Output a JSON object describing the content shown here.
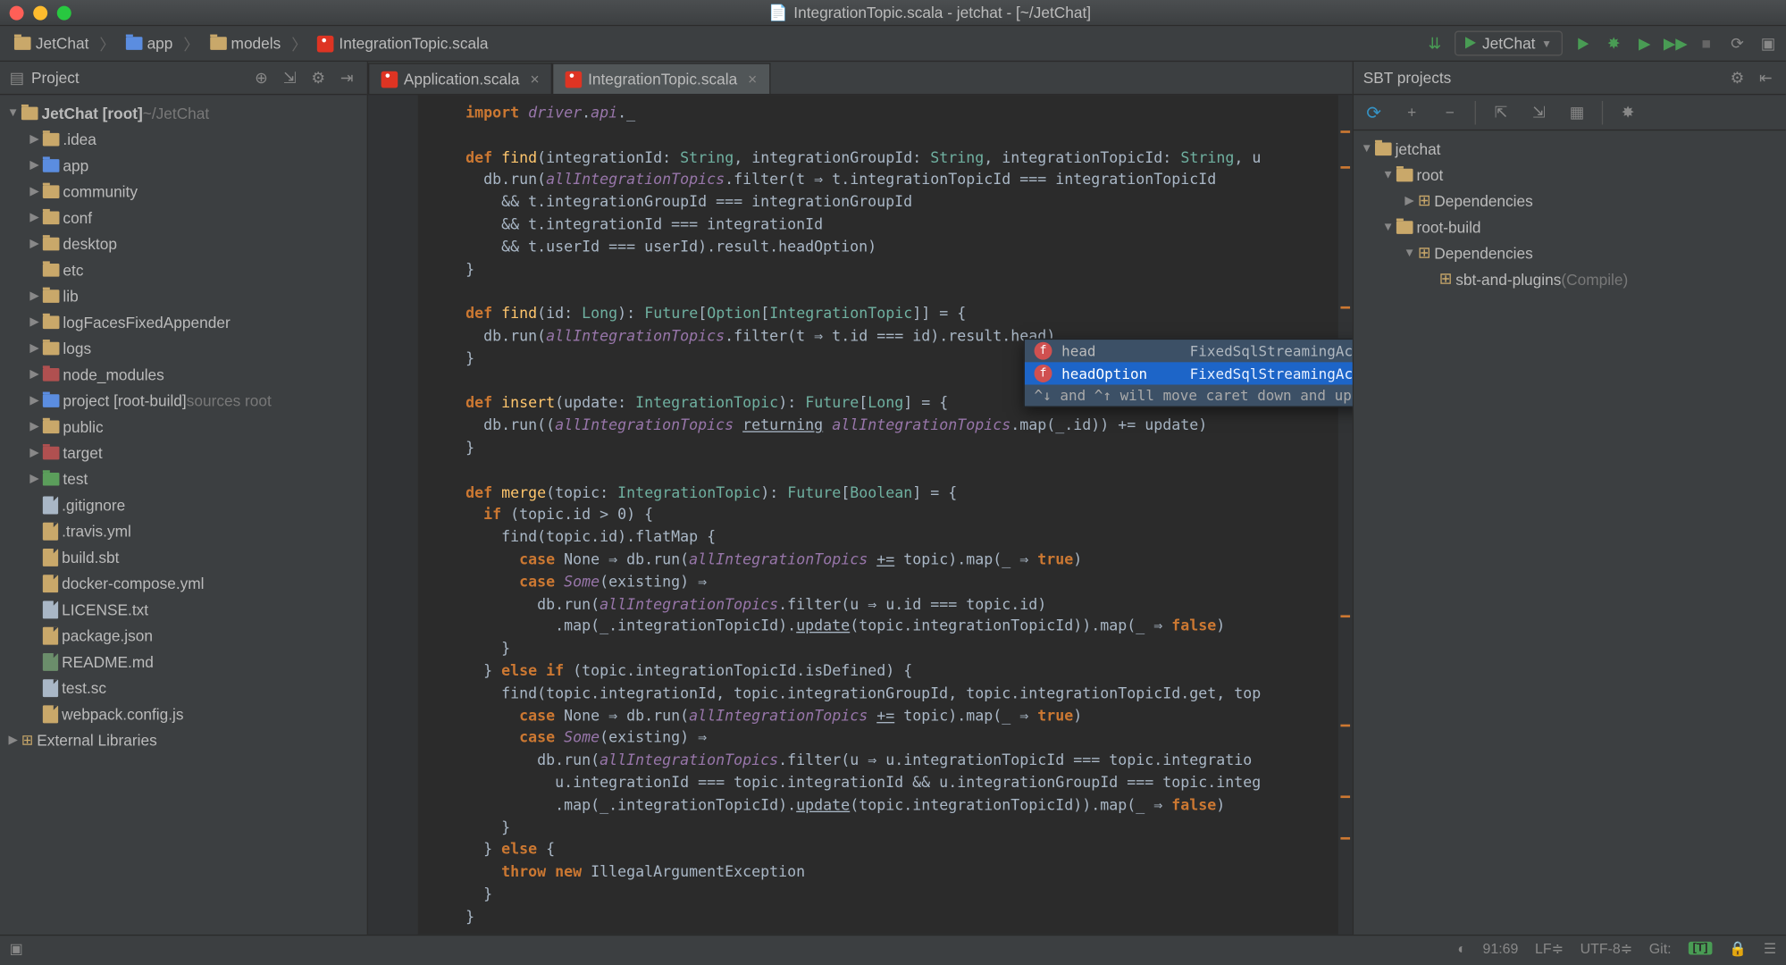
{
  "window": {
    "title": "IntegrationTopic.scala - jetchat - [~/JetChat]"
  },
  "breadcrumbs": [
    {
      "label": "JetChat",
      "icon": "folder"
    },
    {
      "label": "app",
      "icon": "folder-blue"
    },
    {
      "label": "models",
      "icon": "folder"
    },
    {
      "label": "IntegrationTopic.scala",
      "icon": "scala"
    }
  ],
  "runConfig": {
    "label": "JetChat"
  },
  "projectPanel": {
    "title": "Project"
  },
  "projectTree": [
    {
      "depth": 0,
      "exp": "▼",
      "icon": "folder",
      "label": "JetChat [root]",
      "suffix": "~/JetChat",
      "bold": true
    },
    {
      "depth": 1,
      "exp": "▶",
      "icon": "folder",
      "label": ".idea"
    },
    {
      "depth": 1,
      "exp": "▶",
      "icon": "folder-blue",
      "label": "app"
    },
    {
      "depth": 1,
      "exp": "▶",
      "icon": "folder",
      "label": "community"
    },
    {
      "depth": 1,
      "exp": "▶",
      "icon": "folder",
      "label": "conf"
    },
    {
      "depth": 1,
      "exp": "▶",
      "icon": "folder",
      "label": "desktop"
    },
    {
      "depth": 1,
      "exp": "",
      "icon": "folder",
      "label": "etc"
    },
    {
      "depth": 1,
      "exp": "▶",
      "icon": "folder",
      "label": "lib"
    },
    {
      "depth": 1,
      "exp": "▶",
      "icon": "folder",
      "label": "logFacesFixedAppender"
    },
    {
      "depth": 1,
      "exp": "▶",
      "icon": "folder",
      "label": "logs"
    },
    {
      "depth": 1,
      "exp": "▶",
      "icon": "folder-red",
      "label": "node_modules"
    },
    {
      "depth": 1,
      "exp": "▶",
      "icon": "folder-blue",
      "label": "project [root-build]",
      "suffix": "sources root"
    },
    {
      "depth": 1,
      "exp": "▶",
      "icon": "folder",
      "label": "public"
    },
    {
      "depth": 1,
      "exp": "▶",
      "icon": "folder-red",
      "label": "target"
    },
    {
      "depth": 1,
      "exp": "▶",
      "icon": "folder-green",
      "label": "test"
    },
    {
      "depth": 1,
      "exp": "",
      "icon": "file",
      "label": ".gitignore"
    },
    {
      "depth": 1,
      "exp": "",
      "icon": "file-y",
      "label": ".travis.yml"
    },
    {
      "depth": 1,
      "exp": "",
      "icon": "file-y",
      "label": "build.sbt"
    },
    {
      "depth": 1,
      "exp": "",
      "icon": "file-y",
      "label": "docker-compose.yml"
    },
    {
      "depth": 1,
      "exp": "",
      "icon": "file",
      "label": "LICENSE.txt"
    },
    {
      "depth": 1,
      "exp": "",
      "icon": "file-y",
      "label": "package.json"
    },
    {
      "depth": 1,
      "exp": "",
      "icon": "file-md",
      "label": "README.md"
    },
    {
      "depth": 1,
      "exp": "",
      "icon": "file",
      "label": "test.sc"
    },
    {
      "depth": 1,
      "exp": "",
      "icon": "file-y",
      "label": "webpack.config.js"
    },
    {
      "depth": 0,
      "exp": "▶",
      "icon": "lib",
      "label": "External Libraries"
    }
  ],
  "tabs": [
    {
      "label": "Application.scala",
      "active": false
    },
    {
      "label": "IntegrationTopic.scala",
      "active": true
    }
  ],
  "sbt": {
    "title": "SBT projects",
    "tree": [
      {
        "depth": 0,
        "exp": "▼",
        "icon": "folder",
        "label": "jetchat"
      },
      {
        "depth": 1,
        "exp": "▼",
        "icon": "folder",
        "label": "root"
      },
      {
        "depth": 2,
        "exp": "▶",
        "icon": "dep",
        "label": "Dependencies"
      },
      {
        "depth": 1,
        "exp": "▼",
        "icon": "folder",
        "label": "root-build"
      },
      {
        "depth": 2,
        "exp": "▼",
        "icon": "dep",
        "label": "Dependencies"
      },
      {
        "depth": 3,
        "exp": "",
        "icon": "dep",
        "label": "sbt-and-plugins",
        "suffix": "(Compile)"
      }
    ]
  },
  "completion": {
    "items": [
      {
        "name": "head",
        "sig": "FixedSqlStreamingAction.this.ResultAction[IntegrationTopics…"
      },
      {
        "name": "headOption",
        "sig": "FixedSqlStreamingAction.this.ResultAction[Option[Integra"
      }
    ],
    "hint": "^↓ and ^↑ will move caret down and up in the editor",
    "link": ">>"
  },
  "status": {
    "pos": "91:69",
    "sep": "LF≑",
    "enc": "UTF-8≑",
    "git": "Git:",
    "tag": "[T]"
  }
}
